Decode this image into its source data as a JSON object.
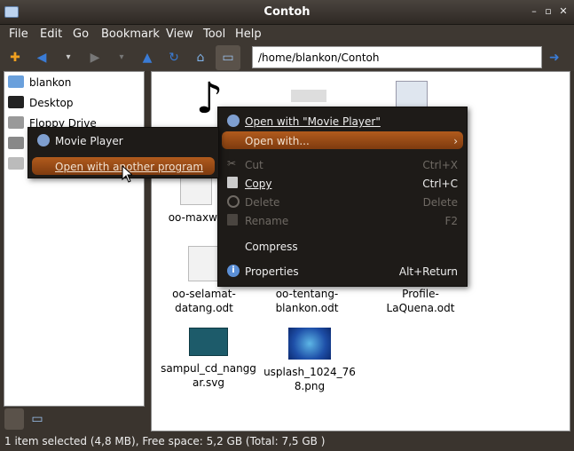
{
  "window": {
    "title": "Contoh"
  },
  "menubar": {
    "items": [
      "File",
      "Edit",
      "Go",
      "Bookmark",
      "View",
      "Tool",
      "Help"
    ]
  },
  "toolbar": {
    "path": "/home/blankon/Contoh"
  },
  "sidebar": {
    "items": [
      "blankon",
      "Desktop",
      "Floppy Drive",
      "",
      ""
    ]
  },
  "files": [
    {
      "name_line1": "",
      "name_line2": "",
      "icon": "music-note-icon"
    },
    {
      "name_line1": "",
      "name_line2": "",
      "icon": "image-icon"
    },
    {
      "name_line1": "",
      "name_line2": "",
      "icon": "spreadsheet-icon"
    },
    {
      "name_line1": "oo-maxwe",
      "name_line2": "",
      "icon": "document-icon"
    },
    {
      "name_line1": "oo-selamat-",
      "name_line2": "datang.odt",
      "icon": "document-icon"
    },
    {
      "name_line1": "oo-tentang-",
      "name_line2": "blankon.odt",
      "icon": "document-icon"
    },
    {
      "name_line1": "Profile-",
      "name_line2": "LaQuena.odt",
      "icon": "document-icon"
    },
    {
      "name_line1": "sampul_cd_nangg",
      "name_line2": "ar.svg",
      "icon": "svg-image-icon"
    },
    {
      "name_line1": "usplash_1024_76",
      "name_line2": "8.png",
      "icon": "png-image-icon"
    }
  ],
  "context_menu": {
    "open_with_default": "Open with \"Movie Player\"",
    "open_with": "Open with...",
    "cut": "Cut",
    "cut_shortcut": "Ctrl+X",
    "copy": "Copy",
    "copy_shortcut": "Ctrl+C",
    "delete": "Delete",
    "delete_shortcut": "Delete",
    "rename": "Rename",
    "rename_shortcut": "F2",
    "compress": "Compress",
    "properties": "Properties",
    "properties_shortcut": "Alt+Return"
  },
  "submenu": {
    "movie_player": "Movie Player",
    "open_another": "Open with another program"
  },
  "status": {
    "text": "1 item selected (4,8 MB), Free space: 5,2 GB (Total: 7,5 GB )"
  }
}
